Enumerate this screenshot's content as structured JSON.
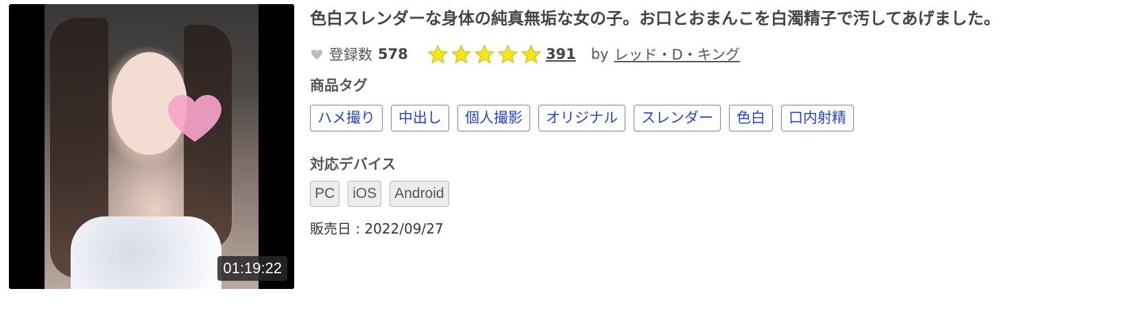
{
  "thumbnail": {
    "duration": "01:19:22"
  },
  "title": "色白スレンダーな身体の純真無垢な女の子。お口とおまんこを白濁精子で汚してあげました。",
  "meta": {
    "favorite_icon": "heart-icon",
    "registration_label": "登録数",
    "registration_count": "578",
    "rating": 5,
    "rating_max": 5,
    "rating_count": "391",
    "by_label": "by",
    "author": "レッド・D・キング"
  },
  "tags_label": "商品タグ",
  "tags": [
    "ハメ撮り",
    "中出し",
    "個人撮影",
    "オリジナル",
    "スレンダー",
    "色白",
    "口内射精"
  ],
  "devices_label": "対応デバイス",
  "devices": [
    "PC",
    "iOS",
    "Android"
  ],
  "release": "販売日 : 2022/09/27",
  "colors": {
    "tag_border": "#6e7fd0",
    "tag_text": "#2a45c8",
    "star": "#f4e51f"
  }
}
